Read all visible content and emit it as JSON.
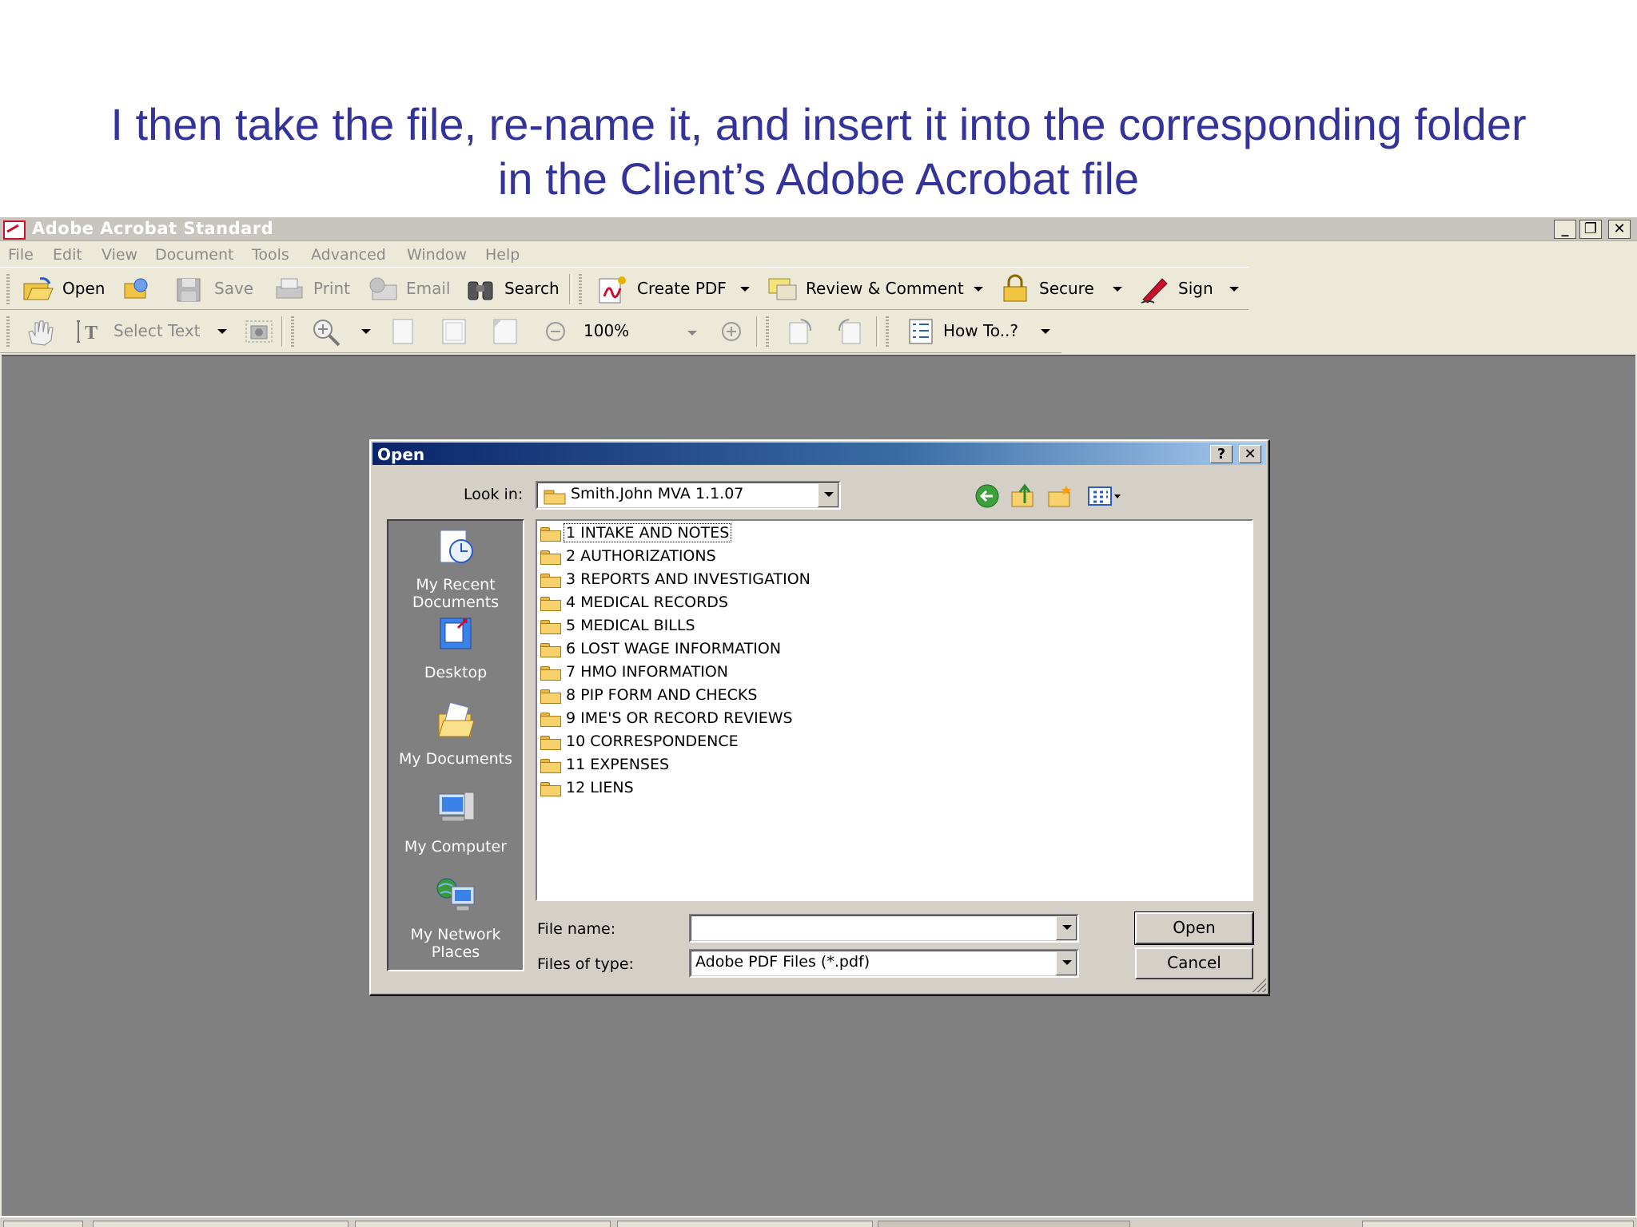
{
  "slide": {
    "caption_line1": "I then take the file, re-name it, and insert it into the corresponding folder",
    "caption_line2": "in the Client’s Adobe Acrobat file"
  },
  "window": {
    "title": "Adobe Acrobat Standard",
    "caption_buttons": [
      "_",
      "❐",
      "✕"
    ]
  },
  "menu": [
    "File",
    "Edit",
    "View",
    "Document",
    "Tools",
    "Advanced",
    "Window",
    "Help"
  ],
  "toolbar1": {
    "open": "Open",
    "save": "Save",
    "print": "Print",
    "email": "Email",
    "search": "Search",
    "create_pdf": "Create PDF",
    "review_comment": "Review & Comment",
    "secure": "Secure",
    "sign": "Sign"
  },
  "toolbar2": {
    "select_text": "Select Text",
    "zoom": "100%",
    "how_to": "How To..?"
  },
  "dialog": {
    "title": "Open",
    "help_btn": "?",
    "close_btn": "✕",
    "look_in_label": "Look in:",
    "look_in_value": "Smith.John MVA 1.1.07",
    "places": [
      {
        "label_line1": "My Recent",
        "label_line2": "Documents"
      },
      {
        "label_line1": "Desktop",
        "label_line2": ""
      },
      {
        "label_line1": "My Documents",
        "label_line2": ""
      },
      {
        "label_line1": "My Computer",
        "label_line2": ""
      },
      {
        "label_line1": "My Network",
        "label_line2": "Places"
      }
    ],
    "folders": [
      "1 INTAKE AND NOTES",
      "2 AUTHORIZATIONS",
      "3 REPORTS AND INVESTIGATION",
      "4 MEDICAL RECORDS",
      "5 MEDICAL BILLS",
      "6 LOST WAGE INFORMATION",
      "7 HMO INFORMATION",
      "8 PIP FORM AND CHECKS",
      "9 IME'S OR RECORD REVIEWS",
      "10 CORRESPONDENCE",
      "11 EXPENSES",
      "12 LIENS"
    ],
    "file_name_label": "File name:",
    "file_name_value": "",
    "files_of_type_label": "Files of type:",
    "files_of_type_value": "Adobe PDF Files (*.pdf)",
    "open_btn": "Open",
    "cancel_btn": "Cancel"
  }
}
